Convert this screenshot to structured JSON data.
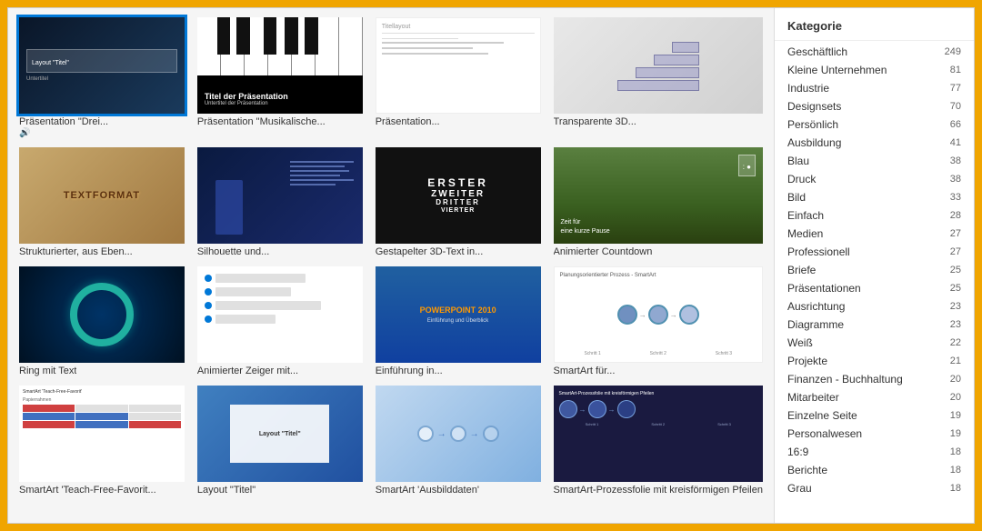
{
  "gallery": {
    "items": [
      {
        "id": "item-1",
        "label": "Präsentation \"Drei...",
        "selected": true,
        "thumb_type": "drei"
      },
      {
        "id": "item-2",
        "label": "Präsentation \"Musikalische...",
        "selected": false,
        "thumb_type": "musik"
      },
      {
        "id": "item-3",
        "label": "Präsentation...",
        "selected": false,
        "thumb_type": "titel"
      },
      {
        "id": "item-4",
        "label": "Transparente 3D...",
        "selected": false,
        "thumb_type": "3d"
      },
      {
        "id": "item-5",
        "label": "Strukturierter, aus Eben...",
        "selected": false,
        "thumb_type": "struktur"
      },
      {
        "id": "item-6",
        "label": "Silhouette und...",
        "selected": false,
        "thumb_type": "silhouette"
      },
      {
        "id": "item-7",
        "label": "Gestapelter 3D-Text in...",
        "selected": false,
        "thumb_type": "3dtext"
      },
      {
        "id": "item-8",
        "label": "Animierter Countdown",
        "selected": false,
        "thumb_type": "countdown"
      },
      {
        "id": "item-9",
        "label": "Ring mit Text",
        "selected": false,
        "thumb_type": "ring"
      },
      {
        "id": "item-10",
        "label": "Animierter Zeiger mit...",
        "selected": false,
        "thumb_type": "zeiger"
      },
      {
        "id": "item-11",
        "label": "Einführung in...",
        "selected": false,
        "thumb_type": "einfuhrung"
      },
      {
        "id": "item-12",
        "label": "SmartArt für...",
        "selected": false,
        "thumb_type": "smartart"
      },
      {
        "id": "item-13",
        "label": "SmartArt 'Teach-Free-Favorit...",
        "selected": false,
        "thumb_type": "smartbook"
      },
      {
        "id": "item-14",
        "label": "Layout \"Titel\"",
        "selected": false,
        "thumb_type": "layouttitel"
      },
      {
        "id": "item-15",
        "label": "SmartArt 'Ausbilddaten'",
        "selected": false,
        "thumb_type": "ausbildung"
      },
      {
        "id": "item-16",
        "label": "SmartArt-Prozessfolie mit kreisförmigen Pfeilen",
        "selected": false,
        "thumb_type": "prozesspfeile"
      }
    ]
  },
  "sidebar": {
    "title": "Kategorie",
    "categories": [
      {
        "name": "Geschäftlich",
        "count": 249
      },
      {
        "name": "Kleine Unternehmen",
        "count": 81
      },
      {
        "name": "Industrie",
        "count": 77
      },
      {
        "name": "Designsets",
        "count": 70
      },
      {
        "name": "Persönlich",
        "count": 66
      },
      {
        "name": "Ausbildung",
        "count": 41
      },
      {
        "name": "Blau",
        "count": 38
      },
      {
        "name": "Druck",
        "count": 38
      },
      {
        "name": "Bild",
        "count": 33
      },
      {
        "name": "Einfach",
        "count": 28
      },
      {
        "name": "Medien",
        "count": 27
      },
      {
        "name": "Professionell",
        "count": 27
      },
      {
        "name": "Briefe",
        "count": 25
      },
      {
        "name": "Präsentationen",
        "count": 25
      },
      {
        "name": "Ausrichtung",
        "count": 23
      },
      {
        "name": "Diagramme",
        "count": 23
      },
      {
        "name": "Weiß",
        "count": 22
      },
      {
        "name": "Projekte",
        "count": 21
      },
      {
        "name": "Finanzen - Buchhaltung",
        "count": 20
      },
      {
        "name": "Mitarbeiter",
        "count": 20
      },
      {
        "name": "Einzelne Seite",
        "count": 19
      },
      {
        "name": "Personalwesen",
        "count": 19
      },
      {
        "name": "16:9",
        "count": 18
      },
      {
        "name": "Berichte",
        "count": 18
      },
      {
        "name": "Grau",
        "count": 18
      }
    ]
  }
}
